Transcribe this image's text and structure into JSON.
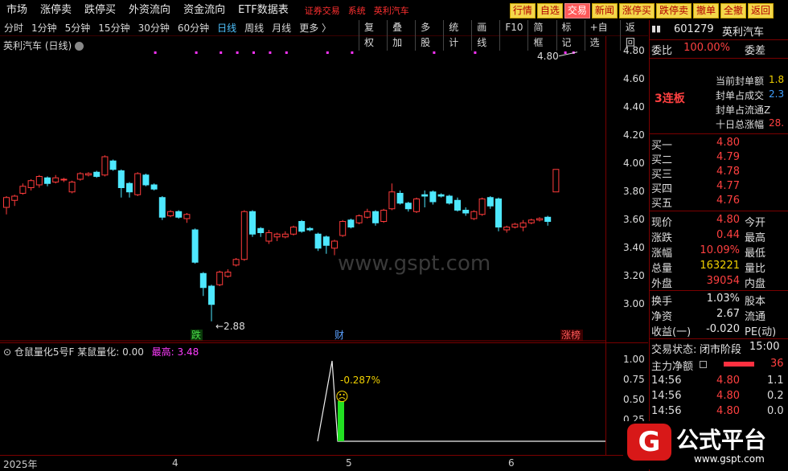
{
  "topbar": {
    "menu": [
      "市场",
      "涨停卖",
      "跌停买",
      "外资流向",
      "资金流向",
      "ETF数据表"
    ],
    "center": [
      "证券交易",
      "系统",
      "英利汽车"
    ],
    "buttons": [
      "行情",
      "自选",
      "交易",
      "新闻",
      "涨停买",
      "跌停卖",
      "撤单",
      "全撤",
      "返回"
    ],
    "active_button": "交易"
  },
  "toolbar": {
    "periods": [
      "分时",
      "1分钟",
      "5分钟",
      "15分钟",
      "30分钟",
      "60分钟",
      "日线",
      "周线",
      "月线",
      "更多 〉"
    ],
    "selected_period": "日线",
    "tools": [
      "复权",
      "叠加",
      "多股",
      "统计",
      "画线",
      "F10",
      "简框",
      "标记",
      "+自选",
      "返回"
    ]
  },
  "chart": {
    "title": "英利汽车 (日线)",
    "yticks": [
      "4.80",
      "4.60",
      "4.40",
      "4.20",
      "4.00",
      "3.80",
      "3.60",
      "3.40",
      "3.20",
      "3.00"
    ],
    "low_label": "←2.88",
    "high_label": "4.80",
    "markers": [
      "跌",
      "财",
      "涨榜"
    ],
    "watermark": "www.gspt.com"
  },
  "chart_data": {
    "type": "candlestick",
    "ylim": [
      2.85,
      4.85
    ],
    "candles": [
      [
        3.69,
        3.76,
        3.64,
        3.77
      ],
      [
        3.74,
        3.77,
        3.7,
        3.78
      ],
      [
        3.79,
        3.84,
        3.78,
        3.86
      ],
      [
        3.83,
        3.88,
        3.81,
        3.89
      ],
      [
        3.85,
        3.91,
        3.83,
        3.92
      ],
      [
        3.9,
        3.86,
        3.84,
        3.91
      ],
      [
        3.87,
        3.9,
        3.86,
        3.92
      ],
      [
        3.89,
        3.89,
        3.87,
        3.9
      ],
      [
        3.8,
        3.87,
        3.79,
        3.88
      ],
      [
        3.89,
        3.93,
        3.88,
        3.94
      ],
      [
        3.92,
        3.93,
        3.91,
        3.94
      ],
      [
        3.94,
        3.91,
        3.9,
        3.95
      ],
      [
        3.92,
        4.05,
        3.91,
        4.06
      ],
      [
        4.02,
        3.96,
        3.95,
        4.03
      ],
      [
        3.95,
        3.83,
        3.76,
        3.96
      ],
      [
        3.86,
        3.8,
        3.76,
        3.87
      ],
      [
        3.78,
        3.93,
        3.77,
        3.94
      ],
      [
        3.92,
        3.85,
        3.84,
        3.93
      ],
      [
        3.85,
        3.82,
        3.81,
        3.86
      ],
      [
        3.76,
        3.62,
        3.6,
        3.77
      ],
      [
        3.63,
        3.66,
        3.62,
        3.67
      ],
      [
        3.66,
        3.62,
        3.61,
        3.67
      ],
      [
        3.61,
        3.64,
        3.58,
        3.65
      ],
      [
        3.53,
        3.3,
        3.29,
        3.54
      ],
      [
        3.22,
        3.12,
        3.06,
        3.23
      ],
      [
        3.13,
        3.0,
        2.88,
        3.14
      ],
      [
        3.14,
        3.23,
        3.13,
        3.24
      ],
      [
        3.2,
        3.23,
        3.19,
        3.25
      ],
      [
        3.28,
        3.32,
        3.27,
        3.33
      ],
      [
        3.32,
        3.66,
        3.31,
        3.67
      ],
      [
        3.66,
        3.5,
        3.48,
        3.67
      ],
      [
        3.54,
        3.51,
        3.48,
        3.55
      ],
      [
        3.45,
        3.51,
        3.43,
        3.53
      ],
      [
        3.48,
        3.5,
        3.45,
        3.51
      ],
      [
        3.48,
        3.5,
        3.47,
        3.52
      ],
      [
        3.5,
        3.55,
        3.49,
        3.56
      ],
      [
        3.59,
        3.52,
        3.51,
        3.6
      ],
      [
        3.54,
        3.53,
        3.52,
        3.55
      ],
      [
        3.5,
        3.4,
        3.38,
        3.51
      ],
      [
        3.48,
        3.42,
        3.36,
        3.49
      ],
      [
        3.4,
        3.45,
        3.35,
        3.46
      ],
      [
        3.49,
        3.59,
        3.48,
        3.6
      ],
      [
        3.6,
        3.55,
        3.54,
        3.61
      ],
      [
        3.58,
        3.63,
        3.57,
        3.64
      ],
      [
        3.62,
        3.66,
        3.61,
        3.68
      ],
      [
        3.66,
        3.58,
        3.56,
        3.67
      ],
      [
        3.59,
        3.67,
        3.58,
        3.68
      ],
      [
        3.68,
        3.8,
        3.67,
        3.86
      ],
      [
        3.79,
        3.72,
        3.71,
        3.81
      ],
      [
        3.72,
        3.68,
        3.66,
        3.73
      ],
      [
        3.66,
        3.75,
        3.65,
        3.76
      ],
      [
        3.78,
        3.77,
        3.69,
        3.81
      ],
      [
        3.8,
        3.73,
        3.71,
        3.81
      ],
      [
        3.78,
        3.77,
        3.76,
        3.79
      ],
      [
        3.77,
        3.72,
        3.71,
        3.78
      ],
      [
        3.74,
        3.67,
        3.66,
        3.76
      ],
      [
        3.67,
        3.65,
        3.63,
        3.69
      ],
      [
        3.61,
        3.66,
        3.6,
        3.67
      ],
      [
        3.64,
        3.75,
        3.63,
        3.76
      ],
      [
        3.76,
        3.7,
        3.68,
        3.77
      ],
      [
        3.75,
        3.55,
        3.52,
        3.76
      ],
      [
        3.53,
        3.55,
        3.51,
        3.56
      ],
      [
        3.55,
        3.57,
        3.54,
        3.58
      ],
      [
        3.55,
        3.58,
        3.52,
        3.6
      ],
      [
        3.58,
        3.6,
        3.57,
        3.61
      ],
      [
        3.6,
        3.61,
        3.59,
        3.62
      ],
      [
        3.62,
        3.59,
        3.56,
        3.63
      ],
      [
        3.8,
        3.96,
        3.8,
        3.96
      ]
    ],
    "sub_indicator": {
      "title": "仓鼠量化5号F",
      "name": "某鼠量化: 0.00",
      "high": "最高: 3.48",
      "yticks": [
        "1.00",
        "0.75",
        "0.50",
        "0.25"
      ],
      "annotation": "-0.287%",
      "emoji": "☹"
    },
    "xlabels": [
      "2025年",
      "4",
      "5",
      "6"
    ]
  },
  "side": {
    "code": "601279",
    "name": "英利汽车",
    "weibi_label": "委比",
    "weibi_value": "100.00%",
    "weicha_label": "委差",
    "streak": "3连板",
    "seal_rows": [
      "当前封单额",
      "封单占成交",
      "封单占流通Z",
      "十日总涨幅"
    ],
    "seal_vals": [
      "1.8",
      "2.3",
      "",
      "28."
    ],
    "order_book": [
      {
        "label": "买一",
        "price": "4.80"
      },
      {
        "label": "买二",
        "price": "4.79"
      },
      {
        "label": "买三",
        "price": "4.78"
      },
      {
        "label": "买四",
        "price": "4.77"
      },
      {
        "label": "买五",
        "price": "4.76"
      }
    ],
    "stats": [
      {
        "l": "现价",
        "v": "4.80",
        "l2": "今开",
        "c": "red"
      },
      {
        "l": "涨跌",
        "v": "0.44",
        "l2": "最高",
        "c": "red"
      },
      {
        "l": "涨幅",
        "v": "10.09%",
        "l2": "最低",
        "c": "red"
      },
      {
        "l": "总量",
        "v": "163221",
        "l2": "量比",
        "c": "yellow"
      },
      {
        "l": "外盘",
        "v": "39054",
        "l2": "内盘",
        "c": "red"
      }
    ],
    "stats2": [
      {
        "l": "换手",
        "v": "1.03%",
        "l2": "股本",
        "c": "white"
      },
      {
        "l": "净资",
        "v": "2.67",
        "l2": "流通",
        "c": "white"
      },
      {
        "l": "收益(一)",
        "v": "-0.020",
        "l2": "PE(动)",
        "c": "white"
      }
    ],
    "trade_status_label": "交易状态:",
    "trade_status": "闭市阶段",
    "trade_time": "15:00",
    "main_flow_label": "主力净额",
    "main_flow_val": "36",
    "ticks": [
      {
        "t": "14:56",
        "p": "4.80",
        "v": "1.1"
      },
      {
        "t": "14:56",
        "p": "4.80",
        "v": "0.2"
      },
      {
        "t": "14:56",
        "p": "4.80",
        "v": "0.0"
      }
    ]
  },
  "logo": {
    "mark": "G",
    "text": "公式平台",
    "url": "www.gspt.com"
  }
}
